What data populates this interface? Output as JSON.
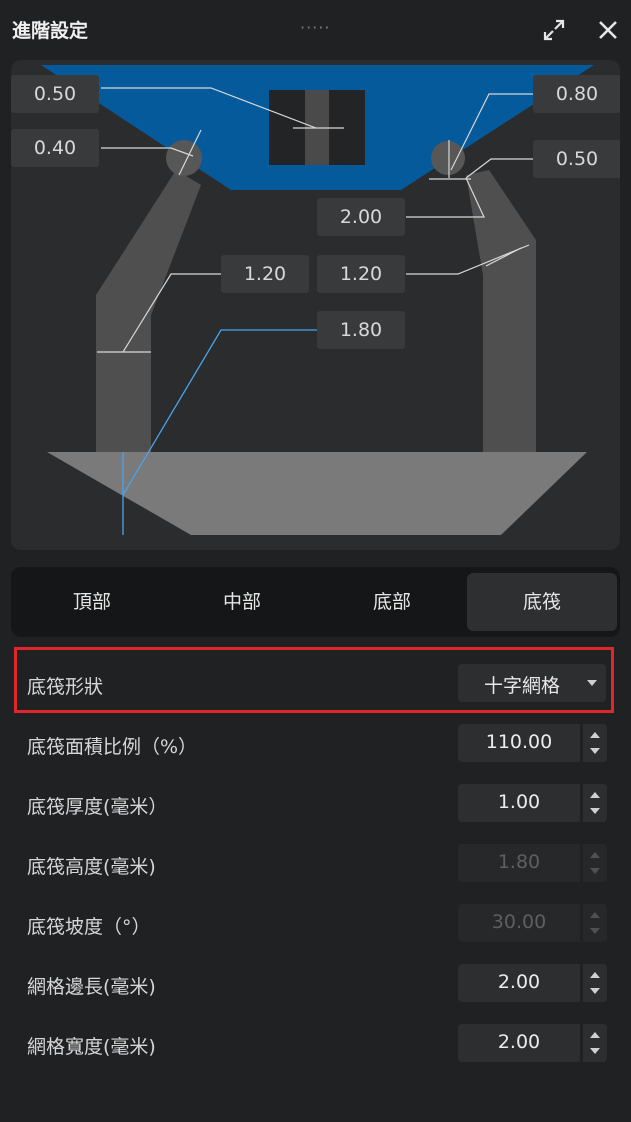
{
  "header": {
    "title": "進階設定",
    "drag_handle": "·····",
    "expand_icon": "expand-icon",
    "close_icon": "close-icon"
  },
  "preview": {
    "colors": {
      "platform": "#045a9b",
      "support": "#4f4f4f",
      "base": "#7a7a7a",
      "highlight_line": "#4aa3ec"
    },
    "dims": {
      "top_left_1": "0.50",
      "top_left_2": "0.40",
      "top_right_1": "0.80",
      "top_right_2": "0.50",
      "middle_1": "2.00",
      "middle_left": "1.20",
      "middle_right": "1.20",
      "raft_height": "1.80"
    }
  },
  "tabs": [
    {
      "label": "頂部",
      "active": false
    },
    {
      "label": "中部",
      "active": false
    },
    {
      "label": "底部",
      "active": false
    },
    {
      "label": "底筏",
      "active": true
    }
  ],
  "settings": {
    "raft_shape": {
      "label": "底筏形狀",
      "value": "十字網格"
    },
    "raft_area_ratio": {
      "label": "底筏面積比例（%）",
      "value": "110.00",
      "enabled": true
    },
    "raft_thickness": {
      "label": "底筏厚度(毫米）",
      "value": "1.00",
      "enabled": true
    },
    "raft_height": {
      "label": "底筏高度(毫米)",
      "value": "1.80",
      "enabled": false
    },
    "raft_slope": {
      "label": "底筏坡度（°）",
      "value": "30.00",
      "enabled": false
    },
    "grid_side": {
      "label": "網格邊長(毫米)",
      "value": "2.00",
      "enabled": true
    },
    "grid_width": {
      "label": "網格寬度(毫米)",
      "value": "2.00",
      "enabled": true
    }
  }
}
